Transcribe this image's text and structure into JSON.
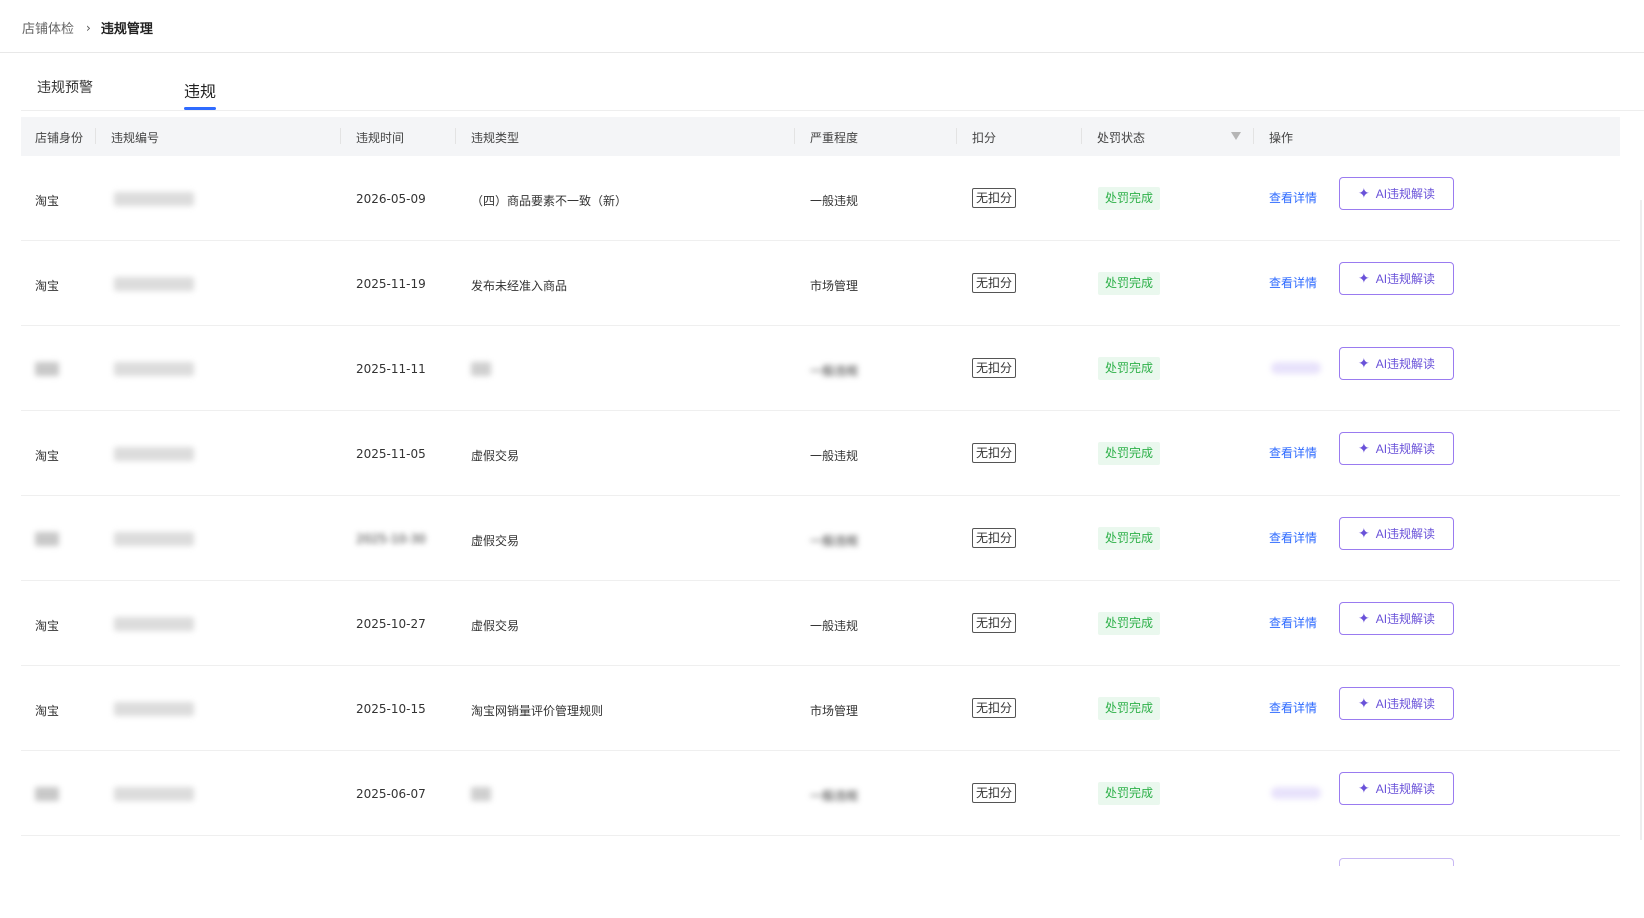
{
  "breadcrumb": {
    "parent": "店铺体检",
    "separator": "›",
    "current": "违规管理"
  },
  "tabs": {
    "warning": "违规预警",
    "violation": "违规"
  },
  "table": {
    "columns": {
      "identity": "店铺身份",
      "id": "违规编号",
      "time": "违规时间",
      "type": "违规类型",
      "severity": "严重程度",
      "deduction": "扣分",
      "status": "处罚状态",
      "action": "操作"
    },
    "rows": [
      {
        "identity": "淘宝",
        "time": "2026-05-09",
        "type": "（四）商品要素不一致（新）",
        "severity": "一般违规",
        "deduction": "无扣分",
        "status": "处罚完成",
        "detail": "查看详情",
        "ai": "AI违规解读"
      },
      {
        "identity": "淘宝",
        "time": "2025-11-19",
        "type": "发布未经准入商品",
        "severity": "市场管理",
        "deduction": "无扣分",
        "status": "处罚完成",
        "detail": "查看详情",
        "ai": "AI违规解读"
      },
      {
        "identity": "",
        "time": "2025-11-11",
        "type": "",
        "severity": "一般违规",
        "deduction": "无扣分",
        "status": "处罚完成",
        "detail": "",
        "ai": "AI违规解读"
      },
      {
        "identity": "淘宝",
        "time": "2025-11-05",
        "type": "虚假交易",
        "severity": "一般违规",
        "deduction": "无扣分",
        "status": "处罚完成",
        "detail": "查看详情",
        "ai": "AI违规解读"
      },
      {
        "identity": "",
        "time": "2025-10-30",
        "type": "虚假交易",
        "severity": "一般违规",
        "deduction": "无扣分",
        "status": "处罚完成",
        "detail": "查看详情",
        "ai": "AI违规解读"
      },
      {
        "identity": "淘宝",
        "time": "2025-10-27",
        "type": "虚假交易",
        "severity": "一般违规",
        "deduction": "无扣分",
        "status": "处罚完成",
        "detail": "查看详情",
        "ai": "AI违规解读"
      },
      {
        "identity": "淘宝",
        "time": "2025-10-15",
        "type": "淘宝网销量评价管理规则",
        "severity": "市场管理",
        "deduction": "无扣分",
        "status": "处罚完成",
        "detail": "查看详情",
        "ai": "AI违规解读"
      },
      {
        "identity": "",
        "time": "2025-06-07",
        "type": "",
        "severity": "一般违规",
        "deduction": "无扣分",
        "status": "处罚完成",
        "detail": "",
        "ai": "AI违规解读"
      }
    ]
  },
  "icons": {
    "ai_icon": "sparkle-icon",
    "filter_icon": "filter-icon"
  },
  "colors": {
    "primary": "#2f6bff",
    "ai_accent": "#6a52d9",
    "status_text": "#2fb14a",
    "status_bg": "#eaf8ee"
  }
}
